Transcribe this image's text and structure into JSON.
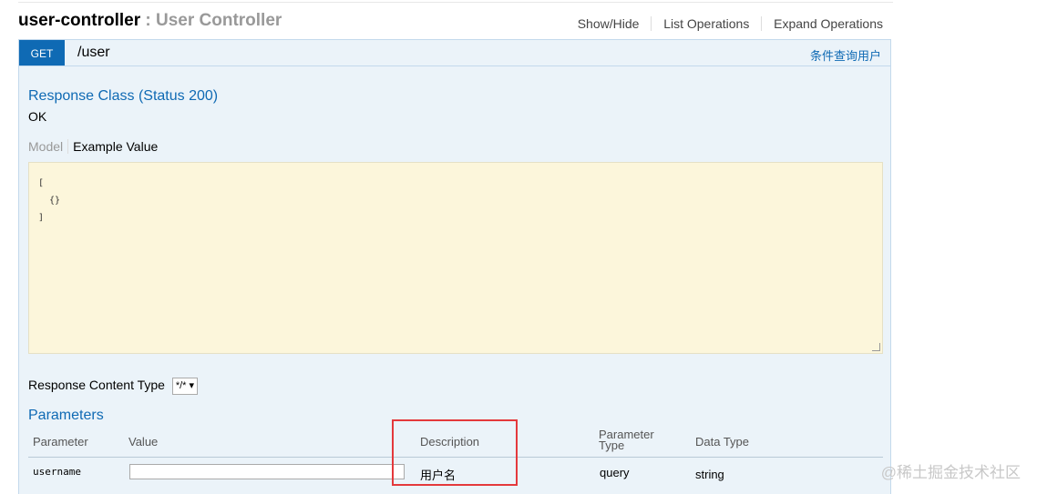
{
  "header": {
    "controller_name": "user-controller",
    "separator": ":",
    "controller_title": "User Controller",
    "links": [
      "Show/Hide",
      "List Operations",
      "Expand Operations"
    ]
  },
  "operation": {
    "method": "GET",
    "path": "/user",
    "summary": "条件查询用户"
  },
  "response": {
    "class_title": "Response Class (Status 200)",
    "status_text": "OK",
    "tabs": [
      "Model",
      "Example Value"
    ],
    "active_tab": "Example Value",
    "example_value": "[\n  {}\n]"
  },
  "content_type": {
    "label": "Response Content Type",
    "selected": "*/*"
  },
  "parameters": {
    "title": "Parameters",
    "headers": [
      "Parameter",
      "Value",
      "Description",
      "Parameter Type",
      "Data Type"
    ],
    "rows": [
      {
        "parameter": "username",
        "value": "",
        "description": "用户名",
        "parameter_type": "query",
        "data_type": "string"
      }
    ]
  },
  "watermark": "@稀土掘金技术社区",
  "colors": {
    "accent": "#0f6ab4",
    "panel": "#ebf3f9",
    "example_bg": "#fcf6db",
    "highlight": "#e4393c"
  }
}
